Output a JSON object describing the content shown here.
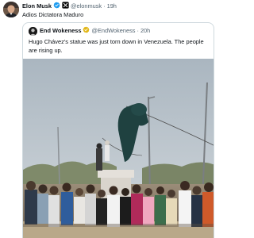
{
  "tweet": {
    "author_name": "Elon Musk",
    "author_handle": "@elonmusk",
    "separator": "·",
    "time": "19h",
    "text": "Adios Dictatora Maduro"
  },
  "quoted": {
    "author_name": "End Wokeness",
    "author_handle": "@EndWokeness",
    "separator": "·",
    "time": "20h",
    "text": "Hugo Chávez's statue was just torn down in Venezuela. The people are rising up."
  },
  "icons": {
    "verified": "verified-badge-icon",
    "x_affiliate": "x-affiliation-icon"
  },
  "colors": {
    "verified_blue": "#1d9bf0",
    "verified_gold": "#e2b719",
    "muted_text": "#536471",
    "border": "#cfd9de"
  }
}
